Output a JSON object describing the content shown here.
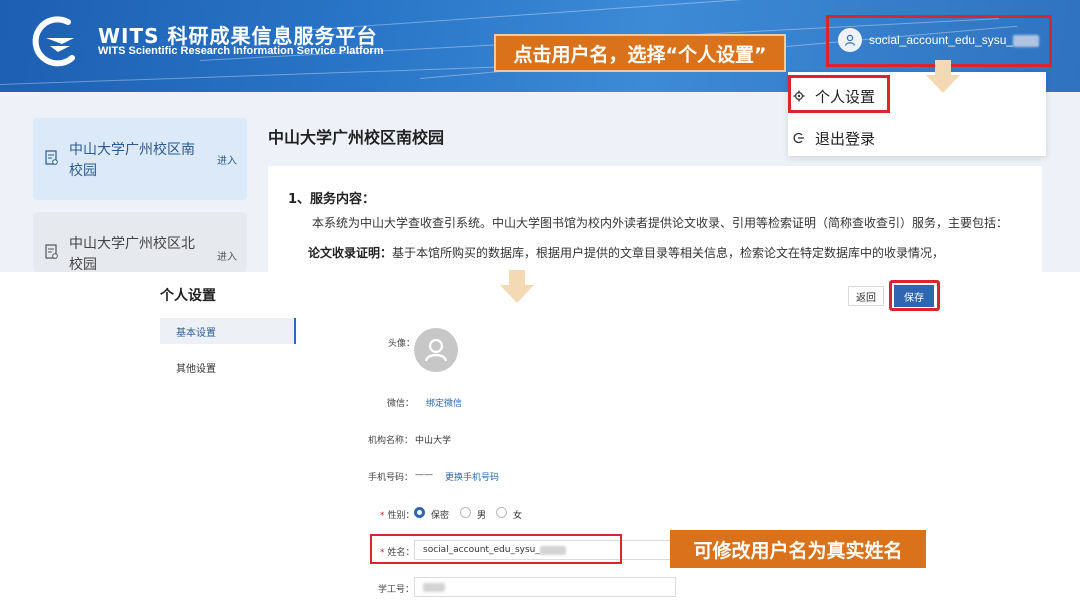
{
  "portal": {
    "logo_title": "WITS 科研成果信息服务平台",
    "logo_subtitle": "WITS Scientific Research Information Service Platform",
    "user_name": "social_account_edu_sysu_",
    "callout_top": "点击用户名，选择“个人设置”",
    "dropdown": {
      "items": [
        {
          "label": "个人设置",
          "icon": "gear-icon"
        },
        {
          "label": "退出登录",
          "icon": "logout-icon"
        }
      ]
    },
    "sidebar": {
      "cards": [
        {
          "title": "中山大学广州校区南校园",
          "action": "进入"
        },
        {
          "title": "中山大学广州校区北校园",
          "action": "进入"
        }
      ]
    },
    "main_title": "中山大学广州校区南校园",
    "section_title": "1、服务内容：",
    "section_body": "本系统为中山大学查收查引系统。中山大学图书馆为校内外读者提供论文收录、引用等检索证明（简称查收查引）服务，主要包括：",
    "item_label": "论文收录证明：",
    "item_text": "基于本馆所购买的数据库，根据用户提供的文章目录等相关信息，检索论文在特定数据库中的收录情况，"
  },
  "settings": {
    "title": "个人设置",
    "nav": [
      "基本设置",
      "其他设置"
    ],
    "back_label": "返回",
    "save_label": "保存",
    "avatar_label": "头像：",
    "wechat_label": "微信：",
    "wechat_link": "绑定微信",
    "org_label": "机构名称：",
    "org_value": "中山大学",
    "phone_label": "手机号码：",
    "phone_value": "——",
    "phone_link": "更换手机号码",
    "gender_label": "性别：",
    "gender_options": [
      "保密",
      "男",
      "女"
    ],
    "gender_selected": "保密",
    "name_label": "姓名：",
    "name_value": "social_account_edu_sysu_",
    "student_id_label": "学工号：",
    "callout_bottom": "可修改用户名为真实姓名"
  },
  "colors": {
    "header_blue": "#2a76c8",
    "callout_orange": "#d9721a",
    "highlight_red": "#d8262c",
    "save_blue": "#2f66b1"
  }
}
